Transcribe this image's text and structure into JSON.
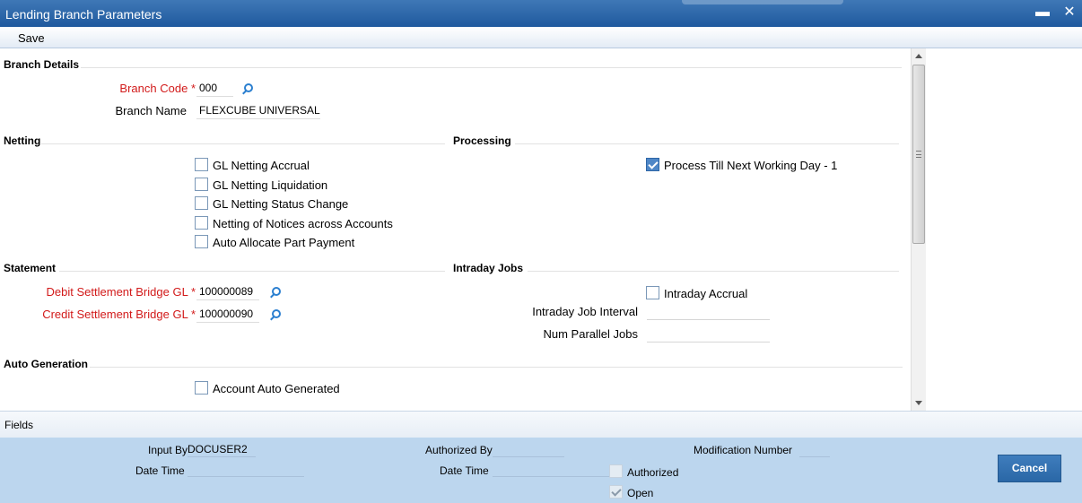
{
  "window": {
    "title": "Lending Branch Parameters",
    "minimize": "▬",
    "close": "✕"
  },
  "toolbar": {
    "save_label": "Save"
  },
  "branch_details": {
    "heading": "Branch Details",
    "branch_code_label": "Branch Code",
    "branch_code_value": "000",
    "branch_name_label": "Branch Name",
    "branch_name_value": "FLEXCUBE UNIVERSAL",
    "required_mark": "*"
  },
  "netting": {
    "heading": "Netting",
    "options": [
      {
        "label": "GL Netting Accrual",
        "checked": false
      },
      {
        "label": "GL Netting Liquidation",
        "checked": false
      },
      {
        "label": "GL Netting Status Change",
        "checked": false
      },
      {
        "label": "Netting of Notices across Accounts",
        "checked": false
      },
      {
        "label": "Auto Allocate Part Payment",
        "checked": false
      }
    ]
  },
  "processing": {
    "heading": "Processing",
    "option_label": "Process Till Next Working Day - 1",
    "checked": true
  },
  "statement": {
    "heading": "Statement",
    "debit_label": "Debit Settlement Bridge GL",
    "debit_value": "100000089",
    "credit_label": "Credit Settlement Bridge GL",
    "credit_value": "100000090"
  },
  "intraday": {
    "heading": "Intraday Jobs",
    "accrual_label": "Intraday Accrual",
    "accrual_checked": false,
    "interval_label": "Intraday Job Interval",
    "interval_value": "",
    "parallel_label": "Num Parallel Jobs",
    "parallel_value": ""
  },
  "auto_generation": {
    "heading": "Auto Generation",
    "option_label": "Account Auto Generated",
    "checked": false
  },
  "fields_bar": {
    "label": "Fields"
  },
  "footer": {
    "input_by_label": "Input By",
    "input_by_value": "DOCUSER2",
    "date_time_label": "Date Time",
    "date_time_value": "",
    "authorized_by_label": "Authorized By",
    "authorized_by_value": "",
    "auth_date_time_label": "Date Time",
    "auth_date_time_value": "",
    "modification_label": "Modification Number",
    "modification_value": "",
    "authorized_label": "Authorized",
    "open_label": "Open",
    "cancel_label": "Cancel"
  }
}
